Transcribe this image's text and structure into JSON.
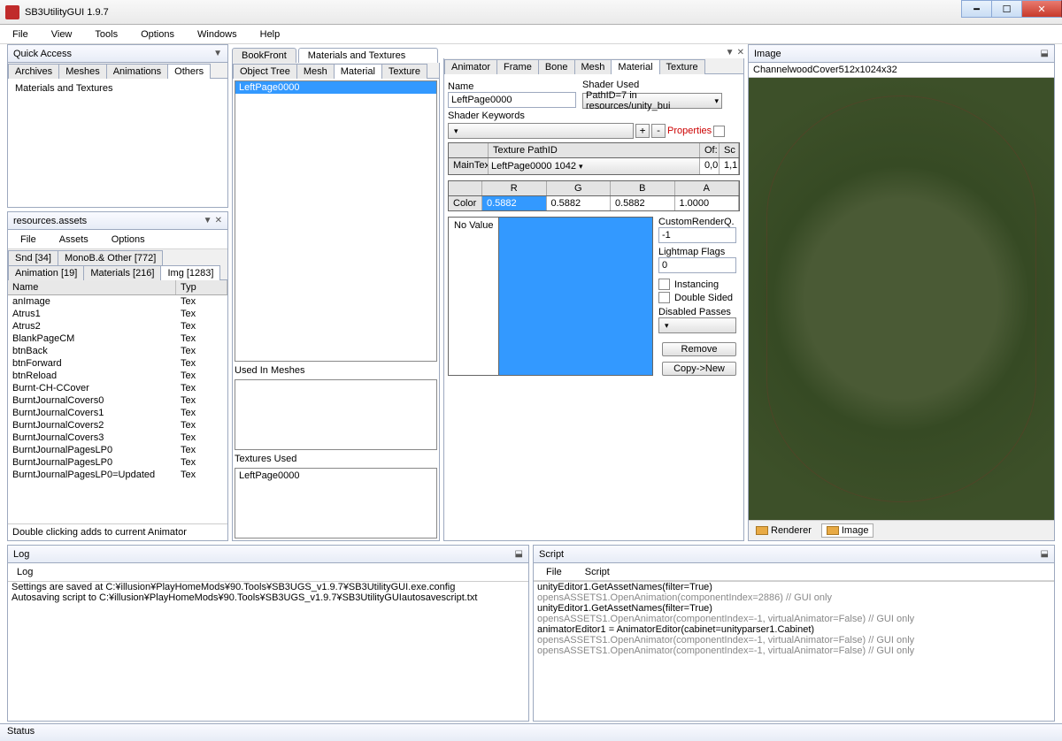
{
  "title": "SB3UtilityGUI 1.9.7",
  "menu": {
    "file": "File",
    "view": "View",
    "tools": "Tools",
    "options": "Options",
    "windows": "Windows",
    "help": "Help"
  },
  "quickaccess": {
    "title": "Quick Access",
    "tabs": {
      "archives": "Archives",
      "meshes": "Meshes",
      "animations": "Animations",
      "others": "Others"
    },
    "content": "Materials and Textures"
  },
  "resources": {
    "title": "resources.assets",
    "menu": {
      "file": "File",
      "assets": "Assets",
      "options": "Options"
    },
    "tabs": {
      "snd": "Snd [34]",
      "monob": "MonoB.& Other [772]",
      "anim": "Animation [19]",
      "mat": "Materials [216]",
      "img": "Img [1283]"
    },
    "cols": {
      "name": "Name",
      "type": "Typ"
    },
    "rows": [
      {
        "n": "anImage",
        "t": "Tex"
      },
      {
        "n": "Atrus1",
        "t": "Tex"
      },
      {
        "n": "Atrus2",
        "t": "Tex"
      },
      {
        "n": "BlankPageCM",
        "t": "Tex"
      },
      {
        "n": "btnBack",
        "t": "Tex"
      },
      {
        "n": "btnForward",
        "t": "Tex"
      },
      {
        "n": "btnReload",
        "t": "Tex"
      },
      {
        "n": "Burnt-CH-CCover",
        "t": "Tex"
      },
      {
        "n": "BurntJournalCovers0",
        "t": "Tex"
      },
      {
        "n": "BurntJournalCovers1",
        "t": "Tex"
      },
      {
        "n": "BurntJournalCovers2",
        "t": "Tex"
      },
      {
        "n": "BurntJournalCovers3",
        "t": "Tex"
      },
      {
        "n": "BurntJournalPagesLP0",
        "t": "Tex"
      },
      {
        "n": "BurntJournalPagesLP0",
        "t": "Tex"
      },
      {
        "n": "BurntJournalPagesLP0=Updated",
        "t": "Tex"
      }
    ],
    "hint": "Double clicking adds to current Animator"
  },
  "center": {
    "toptabs": {
      "book": "BookFront",
      "mat": "Materials and Textures"
    },
    "innertabs": {
      "obj": "Object Tree",
      "mesh": "Mesh",
      "mat": "Material",
      "tex": "Texture"
    },
    "listitem": "LeftPage0000",
    "usedIn": "Used In Meshes",
    "texUsed": "Textures Used",
    "texUsedItem": "LeftPage0000"
  },
  "matpanel": {
    "tabs": {
      "anim": "Animator",
      "frame": "Frame",
      "bone": "Bone",
      "mesh": "Mesh",
      "mat": "Material",
      "tex": "Texture"
    },
    "name_lbl": "Name",
    "name_val": "LeftPage0000",
    "shader_lbl": "Shader Used",
    "shader_val": "PathID=7 in resources/unity_bui",
    "keywords_lbl": "Shader Keywords",
    "props": "Properties",
    "texpath": "Texture PathID",
    "of": "Of:",
    "sc": "Sc",
    "maintex": "MainTex",
    "maintex_val": "LeftPage0000 1042",
    "of_val": "0,0",
    "sc_val": "1,1",
    "r": "R",
    "g": "G",
    "b": "B",
    "a": "A",
    "color": "Color",
    "rv": "0.5882",
    "gv": "0.5882",
    "bv": "0.5882",
    "av": "1.0000",
    "novalue": "No Value",
    "crq": "CustomRenderQ.",
    "crq_val": "-1",
    "lmf": "Lightmap Flags",
    "lmf_val": "0",
    "inst": "Instancing",
    "ds": "Double Sided",
    "dp": "Disabled Passes",
    "remove": "Remove",
    "copynew": "Copy->New"
  },
  "image": {
    "title": "Image",
    "name": "ChannelwoodCover",
    "dim": "512x1024x32",
    "renderer": "Renderer",
    "img": "Image"
  },
  "log": {
    "title": "Log",
    "tab": "Log",
    "lines": [
      "Settings are saved at C:¥illusion¥PlayHomeMods¥90.Tools¥SB3UGS_v1.9.7¥SB3UtilityGUI.exe.config",
      "Autosaving script to C:¥illusion¥PlayHomeMods¥90.Tools¥SB3UGS_v1.9.7¥SB3UtilityGUIautosavescript.txt"
    ]
  },
  "script": {
    "title": "Script",
    "menu": {
      "file": "File",
      "script": "Script"
    },
    "lines": [
      {
        "t": "unityEditor1.GetAssetNames(filter=True)",
        "g": false
      },
      {
        "t": "opensASSETS1.OpenAnimation(componentIndex=2886) // GUI only",
        "g": true
      },
      {
        "t": "unityEditor1.GetAssetNames(filter=True)",
        "g": false
      },
      {
        "t": "opensASSETS1.OpenAnimator(componentIndex=-1, virtualAnimator=False) // GUI only",
        "g": true
      },
      {
        "t": "animatorEditor1 = AnimatorEditor(cabinet=unityparser1.Cabinet)",
        "g": false
      },
      {
        "t": "opensASSETS1.OpenAnimator(componentIndex=-1, virtualAnimator=False) // GUI only",
        "g": true
      },
      {
        "t": "opensASSETS1.OpenAnimator(componentIndex=-1, virtualAnimator=False) // GUI only",
        "g": true
      }
    ]
  },
  "status": "Status"
}
